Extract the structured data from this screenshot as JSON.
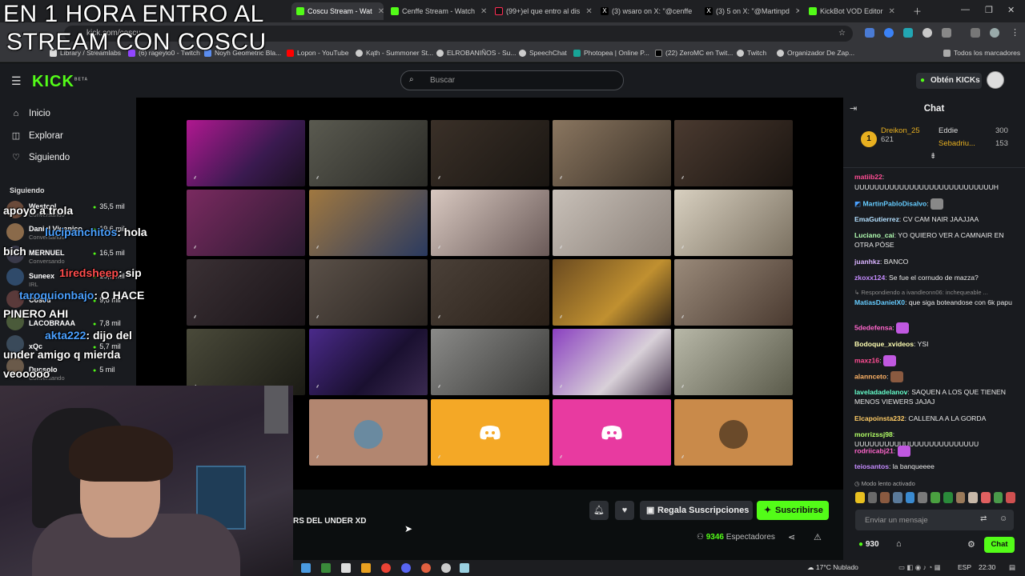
{
  "browser": {
    "tabs": [
      {
        "label": "Coscu Stream - Wat",
        "active": true
      },
      {
        "label": "Cenffe Stream - Watch"
      },
      {
        "label": "(99+)el que entro al dis"
      },
      {
        "label": "(3) wsaro on X: \"@cenffe"
      },
      {
        "label": "(3) 5 on X: \"@Martinpd"
      },
      {
        "label": "KickBot VOD Editor"
      }
    ],
    "url": "kick.com/coscu",
    "bookmarks": [
      "Library / Streamlabs",
      "(6) rageylo0 - Twitch",
      "Noyh Geometric Bla...",
      "Lopon - YouTube",
      "Kąth - Summoner St...",
      "ELROBANIÑOS - Su...",
      "SpeechChat",
      "Photopea | Online P...",
      "(22) ZeroMC en Twit...",
      "Twitch",
      "Organizador De Zap...",
      "Todos los marcadores"
    ]
  },
  "header": {
    "logo": "KICK",
    "logo_sup": "BETA",
    "search_placeholder": "Buscar",
    "kicks_button": "Obtén KICKs"
  },
  "sidebar": {
    "nav": [
      {
        "label": "Inicio",
        "icon": "home-icon"
      },
      {
        "label": "Explorar",
        "icon": "compass-icon"
      },
      {
        "label": "Siguiendo",
        "icon": "heart-icon"
      }
    ],
    "following_title": "Siguiendo",
    "following": [
      {
        "name": "Westcol",
        "status": "Conversando",
        "viewers": "35,5 mil"
      },
      {
        "name": "Daniel Viganico",
        "status": "Conversando",
        "viewers": "19,6 mil"
      },
      {
        "name": "MERNUEL",
        "status": "Conversando",
        "viewers": "16,5 mil"
      },
      {
        "name": "Suneex",
        "status": "IRL",
        "viewers": "10,5 mil"
      },
      {
        "name": "Coscu",
        "status": "",
        "viewers": "9,8 mil"
      },
      {
        "name": "LACOBRAAA",
        "status": "",
        "viewers": "7,8 mil"
      },
      {
        "name": "xQc",
        "status": "",
        "viewers": "5,7 mil"
      },
      {
        "name": "Ducsolo",
        "status": "Conversando",
        "viewers": "5 mil"
      }
    ]
  },
  "stream": {
    "title_fragment": "RS DEL UNDER XD",
    "viewers_count": "9346",
    "viewers_label": "Espectadores",
    "gift_button": "Regala Suscripciones",
    "subscribe_button": "Suscribirse"
  },
  "chat": {
    "title": "Chat",
    "leaderboard": [
      {
        "name": "Dreikon_25",
        "value": "621"
      },
      {
        "name": "Eddie",
        "value": "300"
      },
      {
        "name": "Sebadriu...",
        "value": "153"
      }
    ],
    "messages": [
      {
        "user": "matiib22",
        "text": "",
        "color": "#ff4d94"
      },
      {
        "user": "",
        "text": "UUUUUUUUUUUUUUUUUUUUUUUUUUUUH",
        "color": "#ffffff"
      },
      {
        "user": "MartinPabloDisalvo",
        "text": "",
        "color": "#66ccff"
      },
      {
        "user": "EmaGutierrez",
        "text": "CV CAM NAIR JAAJJAA",
        "color": "#b3e0ff"
      },
      {
        "user": "Luciano_cai",
        "text": "YO QUIERO VER A CAMNAIR EN OTRA PÓSE",
        "color": "#b3ffb3"
      },
      {
        "user": "juanhkz",
        "text": "BANCO",
        "color": "#d9b3ff"
      },
      {
        "user": "zkoxx124",
        "text": "Se fue el cornudo de mazza?",
        "color": "#c58cff"
      },
      {
        "user": "",
        "text": "Respondiendo a ivandleonn06: inchequeable ...",
        "color": "#8a8a8a"
      },
      {
        "user": "MatiasDanielX0",
        "text": "que siga boteandose con 6k papu",
        "color": "#66ccff"
      },
      {
        "user": "5dedefensa",
        "text": "",
        "color": "#ff66cc"
      },
      {
        "user": "Bodoque_xvideos",
        "text": "YSI",
        "color": "#ffffb3"
      },
      {
        "user": "maxz16",
        "text": "",
        "color": "#ff4d94"
      },
      {
        "user": "alannceto",
        "text": "",
        "color": "#ffb366"
      },
      {
        "user": "laveladadelanov",
        "text": "SAQUEN A LOS QUE TIENEN MENOS VIEWERS JAJAJ",
        "color": "#66ffcc"
      },
      {
        "user": "Elcapoinsta232",
        "text": "CALLENLA A LA GORDA",
        "color": "#ffcc66"
      },
      {
        "user": "morrizssj98",
        "text": "UUUUUUUUUUUUUUUUUUUUUUUUU",
        "color": "#b3ff66"
      },
      {
        "user": "rodriicabj21",
        "text": "",
        "color": "#ff66cc"
      },
      {
        "user": "teiosantos",
        "text": "la banqueeee",
        "color": "#c58cff"
      }
    ],
    "slow_mode": "Modo lento activado",
    "input_placeholder": "Enviar un mensaje",
    "points": "930",
    "send_button": "Chat"
  },
  "overlay": {
    "headline_1": "EN 1 HORA ENTRO AL",
    "headline_2": "STREAM CON COSCU",
    "chat_lines": [
      {
        "user": "",
        "text": "apoyo a trola"
      },
      {
        "user": "lucipanchitos",
        "text": ": hola"
      },
      {
        "user": "",
        "text": "bich"
      },
      {
        "user": "1iredsheep",
        "text": ": sip"
      },
      {
        "user": "taroquionbajo",
        "text": ": O HACE"
      },
      {
        "user": "",
        "text": "PINERO AHI"
      },
      {
        "user": "akta222",
        "text": ": dijo del"
      },
      {
        "user": "",
        "text": "under amigo q mierda"
      },
      {
        "user": "",
        "text": "veooooo"
      }
    ]
  },
  "taskbar": {
    "weather": "17°C  Nublado",
    "lang": "ESP",
    "time": "22:30"
  }
}
